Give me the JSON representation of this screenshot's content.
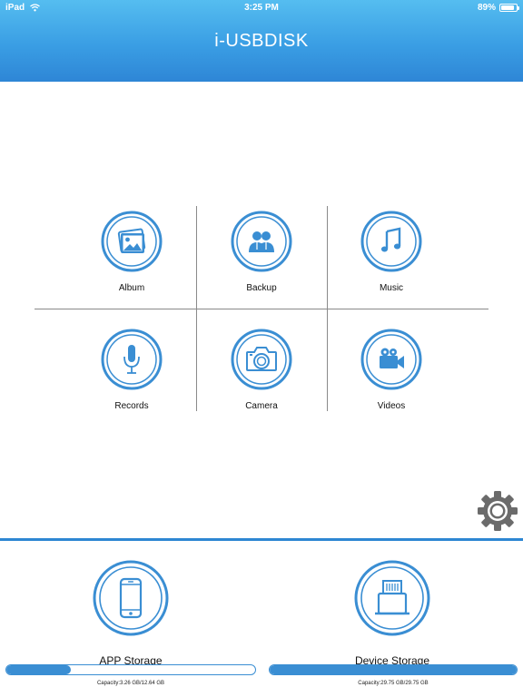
{
  "status_bar": {
    "device": "iPad",
    "time": "3:25 PM",
    "battery": "89%",
    "battery_level": 0.89
  },
  "header": {
    "title": "i-USBDISK"
  },
  "grid": {
    "items": [
      {
        "label": "Album",
        "icon": "album-icon"
      },
      {
        "label": "Backup",
        "icon": "backup-icon"
      },
      {
        "label": "Music",
        "icon": "music-icon"
      },
      {
        "label": "Records",
        "icon": "microphone-icon"
      },
      {
        "label": "Camera",
        "icon": "camera-icon"
      },
      {
        "label": "Videos",
        "icon": "video-camera-icon"
      }
    ]
  },
  "settings": {
    "icon": "gear-icon"
  },
  "storage": {
    "app": {
      "label": "APP Storage",
      "icon": "phone-icon",
      "capacity": "Capacity:3.26 GB/12.64 GB",
      "used_fraction": 0.258
    },
    "device": {
      "label": "Device Storage",
      "icon": "usb-drive-icon",
      "capacity": "Capacity:29.75 GB/29.75 GB",
      "used_fraction": 1.0
    }
  },
  "colors": {
    "accent": "#3a8ed3",
    "header_top": "#55bdf0",
    "header_bottom": "#2e86d6",
    "divider": "#2d86d2",
    "grid_lines": "#8a8a8a"
  }
}
